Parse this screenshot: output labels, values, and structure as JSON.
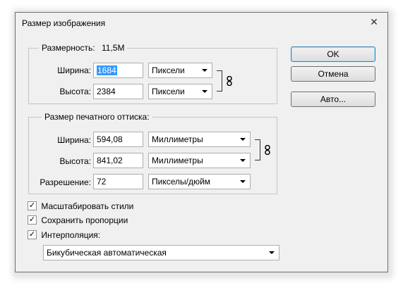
{
  "window": {
    "title": "Размер изображения",
    "close_glyph": "✕"
  },
  "pixel_dimensions": {
    "label": "Размерность:",
    "size": "11,5M",
    "width": {
      "label": "Ширина:",
      "value": "1684",
      "unit": "Пиксели"
    },
    "height": {
      "label": "Высота:",
      "value": "2384",
      "unit": "Пиксели"
    }
  },
  "document_size": {
    "label": "Размер печатного оттиска:",
    "width": {
      "label": "Ширина:",
      "value": "594,08",
      "unit": "Миллиметры"
    },
    "height": {
      "label": "Высота:",
      "value": "841,02",
      "unit": "Миллиметры"
    },
    "resolution": {
      "label": "Разрешение:",
      "value": "72",
      "unit": "Пикселы/дюйм"
    }
  },
  "buttons": {
    "ok": "OK",
    "cancel": "Отмена",
    "auto": "Авто..."
  },
  "options": {
    "scale_styles": {
      "label": "Масштабировать стили",
      "checked": true
    },
    "constrain": {
      "label": "Сохранить пропорции",
      "checked": true
    },
    "resample": {
      "label": "Интерполяция:",
      "checked": true
    },
    "resample_method": "Бикубическая автоматическая"
  },
  "check_glyph": "✓"
}
